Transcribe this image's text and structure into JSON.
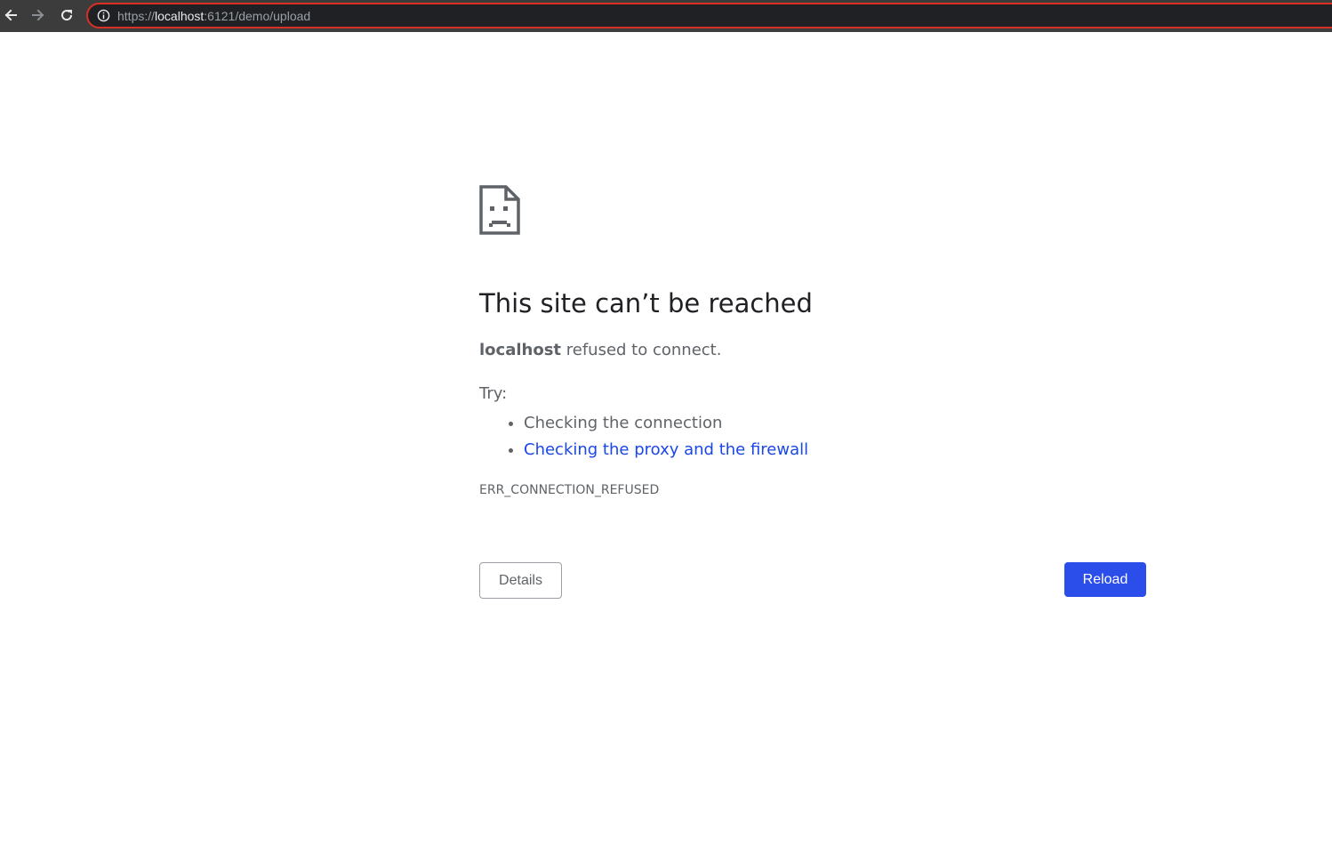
{
  "browser": {
    "url_scheme": "https://",
    "url_host": "localhost",
    "url_rest": ":6121/demo/upload",
    "colors": {
      "toolbar": "#3c3c3c",
      "omnibox": "#202124",
      "omnibox_border_error": "#d93025"
    },
    "icons": {
      "back": "arrow-left-icon",
      "forward": "arrow-right-icon",
      "reload": "reload-icon",
      "site_info": "info-icon"
    }
  },
  "error_page": {
    "icon": "sad-document-icon",
    "title": "This site can’t be reached",
    "host": "localhost",
    "summary_rest": " refused to connect.",
    "try_label": "Try:",
    "suggestions": [
      {
        "text": "Checking the connection",
        "is_link": false
      },
      {
        "text": "Checking the proxy and the firewall",
        "is_link": true
      }
    ],
    "error_code": "ERR_CONNECTION_REFUSED",
    "details_label": "Details",
    "reload_label": "Reload",
    "colors": {
      "title": "#202124",
      "body": "#5f6368",
      "link": "#1a47e8",
      "primary_button": "#2b4de9"
    }
  }
}
